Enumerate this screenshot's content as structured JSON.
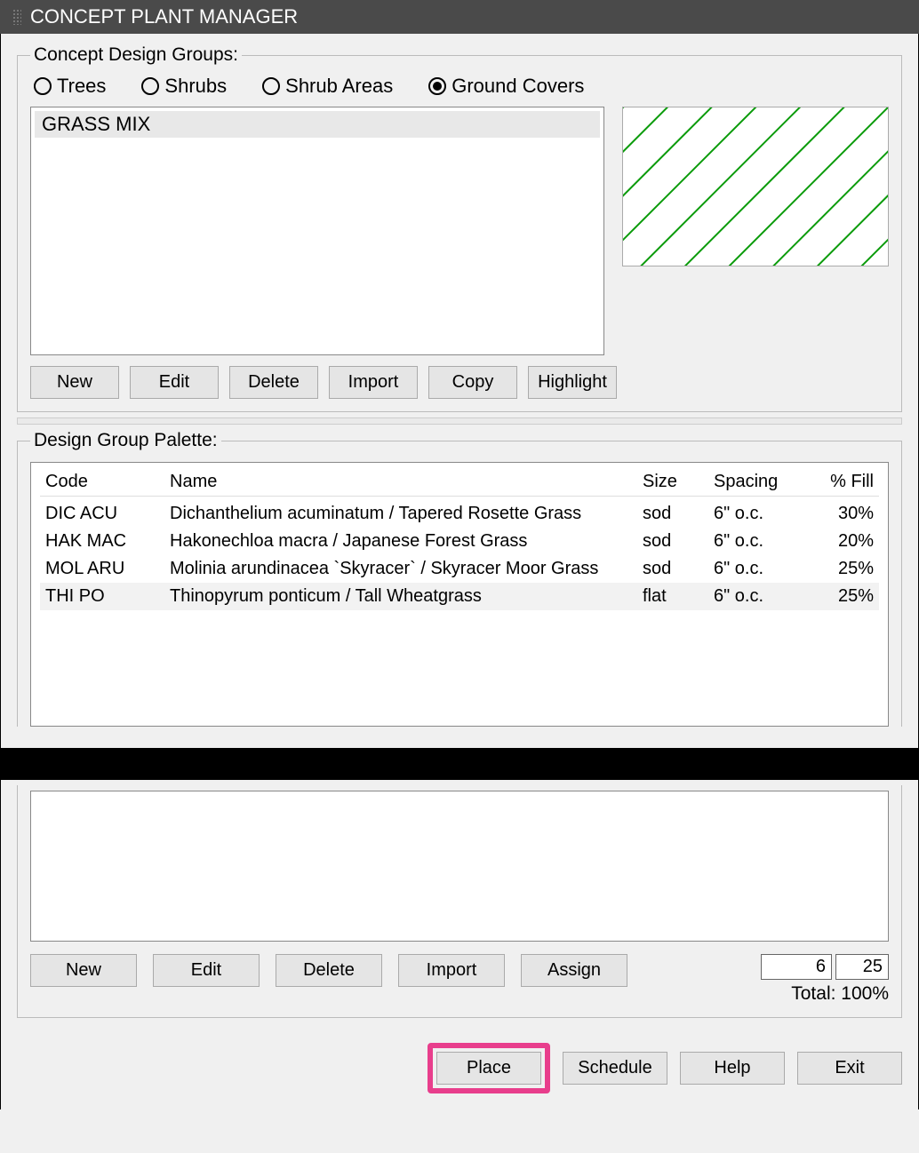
{
  "window": {
    "title": "CONCEPT PLANT MANAGER"
  },
  "groups": {
    "legend": "Concept Design Groups:",
    "radios": {
      "trees": "Trees",
      "shrubs": "Shrubs",
      "shrub_areas": "Shrub Areas",
      "ground_covers": "Ground Covers",
      "selected": "ground_covers"
    },
    "list_selected": "GRASS MIX",
    "buttons": {
      "new": "New",
      "edit": "Edit",
      "delete": "Delete",
      "import": "Import",
      "copy": "Copy",
      "highlight": "Highlight"
    },
    "preview": {
      "hatch_color": "#0a9b0a"
    }
  },
  "palette": {
    "legend": "Design Group Palette:",
    "headers": {
      "code": "Code",
      "name": "Name",
      "size": "Size",
      "spacing": "Spacing",
      "fill": "% Fill"
    },
    "rows": [
      {
        "code": "DIC ACU",
        "name": "Dichanthelium acuminatum / Tapered Rosette Grass",
        "size": "sod",
        "spacing": "6\" o.c.",
        "fill": "30%"
      },
      {
        "code": "HAK MAC",
        "name": "Hakonechloa macra / Japanese Forest Grass",
        "size": "sod",
        "spacing": "6\" o.c.",
        "fill": "20%"
      },
      {
        "code": "MOL ARU",
        "name": "Molinia arundinacea `Skyracer` / Skyracer Moor Grass",
        "size": "sod",
        "spacing": "6\" o.c.",
        "fill": "25%"
      },
      {
        "code": "THI  PO",
        "name": "Thinopyrum  ponticum / Tall Wheatgrass",
        "size": "flat",
        "spacing": "6\" o.c.",
        "fill": "25%"
      }
    ],
    "buttons": {
      "new": "New",
      "edit": "Edit",
      "delete": "Delete",
      "import": "Import",
      "assign": "Assign"
    },
    "inputs": {
      "a": "6",
      "b": "25"
    },
    "total_label": "Total: 100%"
  },
  "footer": {
    "place": "Place",
    "schedule": "Schedule",
    "help": "Help",
    "exit": "Exit"
  }
}
